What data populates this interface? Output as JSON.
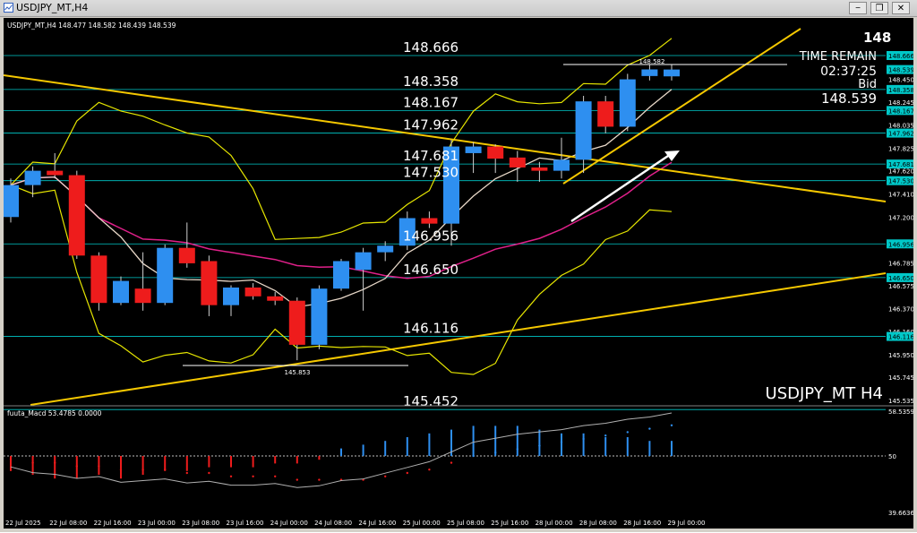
{
  "window": {
    "title": "USDJPY_MT,H4",
    "buttons": [
      "−",
      "❐",
      "✕"
    ]
  },
  "chart_info": {
    "header": "USDJPY_MT,H4  148.477 148.582 148.439 148.539",
    "symbol_watermark": "USDJPY_MT H4",
    "big_price": "148",
    "time_remain_label": "TIME REMAIN",
    "time_remain_value": "02:37:25",
    "bid_label": "Bid",
    "bid_value": "148.539",
    "high_marker": "148.582",
    "low_marker": "145.853"
  },
  "indicator": {
    "header": "fuuta_Macd 53.4785  0.0000",
    "axis_labels": [
      "58.5359",
      "50",
      "39.6636"
    ]
  },
  "colors": {
    "bull": "#2e8ff0",
    "bear": "#ee1c1c",
    "level": "#00c8c8",
    "trend": "#f5c800",
    "band": "#e6e600",
    "ma_pink": "#e0208a",
    "ma_white": "#e8d8c8"
  },
  "chart_data": {
    "type": "candlestick",
    "price_axis_ticks": [
      "148.666",
      "148.539",
      "148.450",
      "148.358",
      "148.245",
      "148.167",
      "148.035",
      "147.962",
      "147.825",
      "147.681",
      "147.620",
      "147.530",
      "147.410",
      "147.200",
      "146.956",
      "146.785",
      "146.650",
      "146.575",
      "146.370",
      "146.160",
      "146.116",
      "145.950",
      "145.745",
      "145.535"
    ],
    "highlighted_ticks": [
      "148.666",
      "148.539",
      "148.358",
      "148.167",
      "147.962",
      "147.681",
      "147.530",
      "146.956",
      "146.650",
      "146.116"
    ],
    "levels": [
      {
        "label": "148.666",
        "value": 148.666
      },
      {
        "label": "148.358",
        "value": 148.358
      },
      {
        "label": "148.167",
        "value": 148.167
      },
      {
        "label": "147.962",
        "value": 147.962
      },
      {
        "label": "147.681",
        "value": 147.681
      },
      {
        "label": "147.530",
        "value": 147.53
      },
      {
        "label": "146.956",
        "value": 146.956
      },
      {
        "label": "146.650",
        "value": 146.65
      },
      {
        "label": "146.116",
        "value": 146.116
      },
      {
        "label": "145.452",
        "value": 145.452
      }
    ],
    "time_labels": [
      "22 Jul 2025",
      "22 Jul 08:00",
      "22 Jul 16:00",
      "23 Jul 00:00",
      "23 Jul 08:00",
      "23 Jul 16:00",
      "24 Jul 00:00",
      "24 Jul 08:00",
      "24 Jul 16:00",
      "25 Jul 00:00",
      "25 Jul 08:00",
      "25 Jul 16:00",
      "28 Jul 00:00",
      "28 Jul 08:00",
      "28 Jul 16:00",
      "29 Jul 00:00"
    ],
    "candles": [
      {
        "o": 147.2,
        "h": 147.55,
        "l": 147.15,
        "c": 147.49
      },
      {
        "o": 147.49,
        "h": 147.66,
        "l": 147.38,
        "c": 147.62
      },
      {
        "o": 147.62,
        "h": 147.78,
        "l": 147.55,
        "c": 147.58
      },
      {
        "o": 147.58,
        "h": 147.62,
        "l": 146.82,
        "c": 146.85
      },
      {
        "o": 146.85,
        "h": 146.88,
        "l": 146.35,
        "c": 146.42
      },
      {
        "o": 146.42,
        "h": 146.66,
        "l": 146.4,
        "c": 146.62
      },
      {
        "o": 146.55,
        "h": 146.88,
        "l": 146.35,
        "c": 146.42
      },
      {
        "o": 146.42,
        "h": 146.95,
        "l": 146.4,
        "c": 146.92
      },
      {
        "o": 146.92,
        "h": 147.15,
        "l": 146.74,
        "c": 146.78
      },
      {
        "o": 146.8,
        "h": 146.85,
        "l": 146.3,
        "c": 146.4
      },
      {
        "o": 146.4,
        "h": 146.58,
        "l": 146.3,
        "c": 146.56
      },
      {
        "o": 146.56,
        "h": 146.6,
        "l": 146.45,
        "c": 146.48
      },
      {
        "o": 146.48,
        "h": 146.52,
        "l": 146.4,
        "c": 146.44
      },
      {
        "o": 146.44,
        "h": 146.47,
        "l": 145.9,
        "c": 146.04
      },
      {
        "o": 146.04,
        "h": 146.58,
        "l": 146.0,
        "c": 146.55
      },
      {
        "o": 146.55,
        "h": 146.82,
        "l": 146.53,
        "c": 146.8
      },
      {
        "o": 146.72,
        "h": 146.92,
        "l": 146.35,
        "c": 146.88
      },
      {
        "o": 146.88,
        "h": 146.98,
        "l": 146.8,
        "c": 146.94
      },
      {
        "o": 146.94,
        "h": 147.25,
        "l": 146.9,
        "c": 147.19
      },
      {
        "o": 147.19,
        "h": 147.25,
        "l": 147.1,
        "c": 147.14
      },
      {
        "o": 147.14,
        "h": 147.9,
        "l": 146.94,
        "c": 147.84
      },
      {
        "o": 147.78,
        "h": 147.88,
        "l": 147.6,
        "c": 147.84
      },
      {
        "o": 147.84,
        "h": 147.86,
        "l": 147.6,
        "c": 147.73
      },
      {
        "o": 147.74,
        "h": 147.8,
        "l": 147.52,
        "c": 147.65
      },
      {
        "o": 147.65,
        "h": 147.7,
        "l": 147.52,
        "c": 147.62
      },
      {
        "o": 147.62,
        "h": 147.92,
        "l": 147.55,
        "c": 147.72
      },
      {
        "o": 147.72,
        "h": 148.3,
        "l": 147.6,
        "c": 148.25
      },
      {
        "o": 148.25,
        "h": 148.3,
        "l": 147.96,
        "c": 148.02
      },
      {
        "o": 148.02,
        "h": 148.5,
        "l": 147.98,
        "c": 148.45
      },
      {
        "o": 148.48,
        "h": 148.58,
        "l": 148.44,
        "c": 148.54
      },
      {
        "o": 148.477,
        "h": 148.582,
        "l": 148.439,
        "c": 148.539
      }
    ],
    "macd_histogram": [
      -4,
      -5,
      -6,
      -6,
      -5,
      -6,
      -5,
      -4,
      -4,
      -3,
      -3,
      -3,
      -2,
      -2,
      -1,
      2,
      3,
      4,
      5,
      6,
      7,
      8,
      8,
      8,
      7,
      6,
      6,
      5,
      5,
      4,
      4
    ],
    "macd_signal": [
      -1,
      -2,
      -2,
      -3,
      -3,
      -4,
      -4,
      -4,
      -5,
      -5,
      -6,
      -6,
      -6,
      -7,
      -7,
      -7,
      -7,
      -6,
      -5,
      -4,
      -2,
      0,
      1,
      2,
      3,
      4,
      5,
      6,
      7,
      8,
      9
    ]
  }
}
